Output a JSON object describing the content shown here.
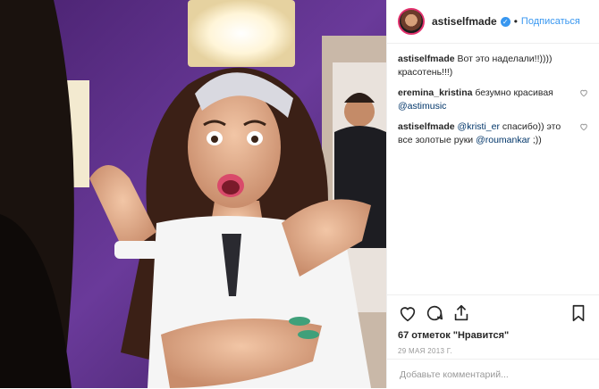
{
  "header": {
    "username": "astiselfmade",
    "separator": "•",
    "follow_label": "Подписаться"
  },
  "comments": [
    {
      "user": "astiselfmade",
      "parts": [
        {
          "text": "Вот это наделали!!)))) красотень!!!)",
          "mention": false
        }
      ],
      "has_like": false
    },
    {
      "user": "eremina_kristina",
      "parts": [
        {
          "text": "безумно красивая ",
          "mention": false
        },
        {
          "text": "@astimusic",
          "mention": true
        }
      ],
      "has_like": true
    },
    {
      "user": "astiselfmade",
      "parts": [
        {
          "text": "@kristi_er",
          "mention": true
        },
        {
          "text": " спасибо)) это все золотые руки ",
          "mention": false
        },
        {
          "text": "@roumankar",
          "mention": true
        },
        {
          "text": " ;))",
          "mention": false
        }
      ],
      "has_like": true
    }
  ],
  "likes_text": "67 отметок \"Нравится\"",
  "date_text": "29 МАЯ 2013 Г.",
  "add_comment_placeholder": "Добавьте комментарий...",
  "icons": {
    "like": "heart-icon",
    "comment": "comment-icon",
    "share": "share-icon",
    "save": "bookmark-icon",
    "verified": "verified-badge-icon"
  },
  "colors": {
    "accent": "#3897f0",
    "wall": "#5b2e8a"
  }
}
